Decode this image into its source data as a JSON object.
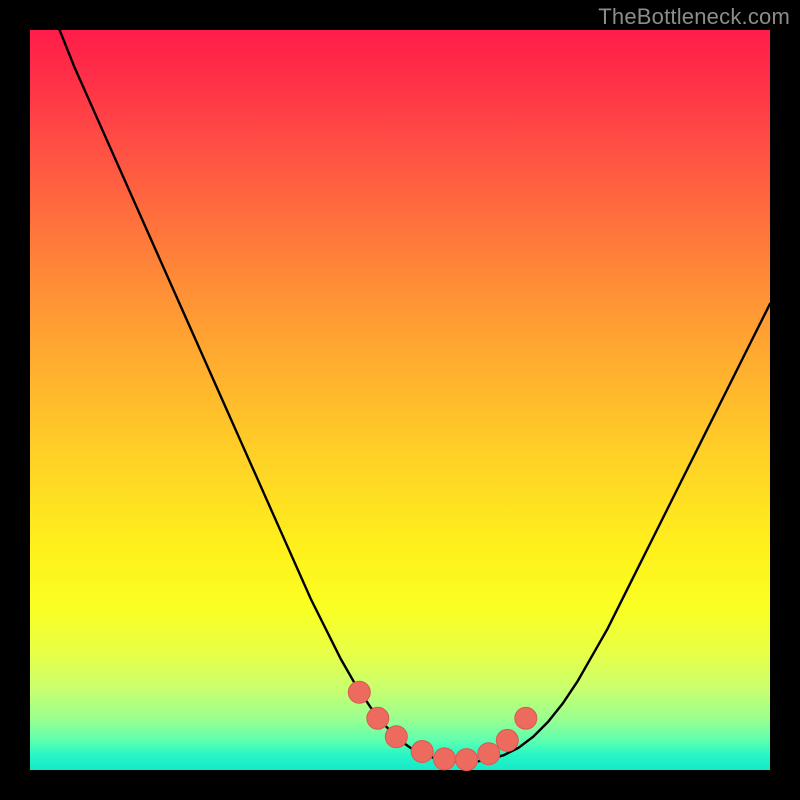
{
  "watermark": "TheBottleneck.com",
  "colors": {
    "frame": "#000000",
    "curve": "#000000",
    "marker_fill": "#ec6a5e",
    "marker_stroke": "#d95a50"
  },
  "chart_data": {
    "type": "line",
    "title": "",
    "xlabel": "",
    "ylabel": "",
    "xlim": [
      0,
      100
    ],
    "ylim": [
      0,
      100
    ],
    "note": "No axis ticks or numeric labels are visible; x/y are normalized 0-100 coordinates inferred from the figure geometry. y=0 is the bottom (green), y=100 is the top (red).",
    "series": [
      {
        "name": "curve",
        "x": [
          4,
          6,
          8,
          10,
          12,
          14,
          16,
          18,
          20,
          22,
          24,
          26,
          28,
          30,
          32,
          34,
          36,
          38,
          40,
          42,
          44,
          46,
          48,
          50,
          52,
          54,
          56,
          58,
          60,
          62,
          64,
          66,
          68,
          70,
          72,
          74,
          76,
          78,
          80,
          82,
          84,
          86,
          88,
          90,
          92,
          94,
          96,
          98,
          100
        ],
        "y": [
          100,
          95,
          90.5,
          86,
          81.5,
          77,
          72.5,
          68,
          63.5,
          59,
          54.5,
          50,
          45.5,
          41,
          36.5,
          32,
          27.5,
          23,
          19,
          15,
          11.5,
          8.5,
          6,
          4,
          2.6,
          1.8,
          1.3,
          1.1,
          1.1,
          1.4,
          2,
          3,
          4.5,
          6.5,
          9,
          12,
          15.5,
          19,
          23,
          27,
          31,
          35,
          39,
          43,
          47,
          51,
          55,
          59,
          63
        ]
      }
    ],
    "markers": {
      "name": "highlighted-points",
      "shape": "circle",
      "x": [
        44.5,
        47,
        49.5,
        53,
        56,
        59,
        62,
        64.5,
        67
      ],
      "y": [
        10.5,
        7,
        4.5,
        2.5,
        1.5,
        1.4,
        2.2,
        4,
        7
      ]
    }
  }
}
